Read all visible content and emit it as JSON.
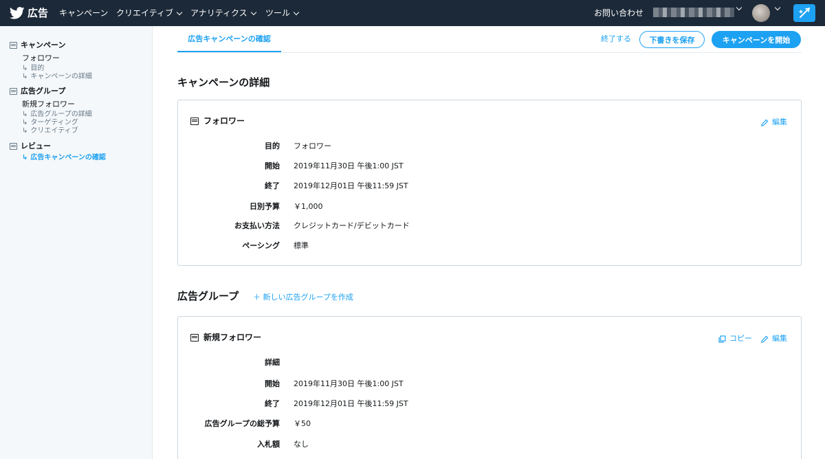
{
  "topbar": {
    "logo_text": "広告",
    "nav": [
      {
        "label": "キャンペーン"
      },
      {
        "label": "クリエイティブ"
      },
      {
        "label": "アナリティクス"
      },
      {
        "label": "ツール"
      }
    ],
    "contact_label": "お問い合わせ"
  },
  "sidebar": {
    "campaign_header": "キャンペーン",
    "campaign_name": "フォロワー",
    "campaign_subs": [
      "目的",
      "キャンペーンの詳細"
    ],
    "adgroup_header": "広告グループ",
    "adgroup_name": "新規フォロワー",
    "adgroup_subs": [
      "広告グループの詳細",
      "ターゲティング",
      "クリエイティブ"
    ],
    "review_header": "レビュー",
    "review_active": "広告キャンペーンの確認",
    "arrow": "↳"
  },
  "header": {
    "tab_label": "広告キャンペーンの確認",
    "end_label": "終了する",
    "draft_label": "下書きを保存",
    "launch_label": "キャンペーンを開始"
  },
  "campaign_section": {
    "title": "キャンペーンの詳細",
    "card_title": "フォロワー",
    "edit_label": "編集",
    "rows": [
      {
        "label": "目的",
        "value": "フォロワー"
      },
      {
        "label": "開始",
        "value": "2019年11月30日 午後1:00 JST"
      },
      {
        "label": "終了",
        "value": "2019年12月01日 午後11:59 JST"
      },
      {
        "label": "日別予算",
        "value": "￥1,000"
      },
      {
        "label": "お支払い方法",
        "value": "クレジットカード/デビットカード"
      },
      {
        "label": "ペーシング",
        "value": "標準"
      }
    ]
  },
  "adgroup_section": {
    "title": "広告グループ",
    "new_label": "新しい広告グループを作成",
    "card_title": "新規フォロワー",
    "copy_label": "コピー",
    "edit_label": "編集",
    "rows": [
      {
        "label": "詳細",
        "value": ""
      },
      {
        "label": "開始",
        "value": "2019年11月30日 午後1:00 JST"
      },
      {
        "label": "終了",
        "value": "2019年12月01日 午後11:59 JST"
      },
      {
        "label": "広告グループの総予算",
        "value": "￥50"
      },
      {
        "label": "入札額",
        "value": "なし"
      }
    ]
  },
  "colors": {
    "accent": "#1da1f2",
    "topbar": "#1c2938",
    "sidebar": "#f5f8fa"
  }
}
